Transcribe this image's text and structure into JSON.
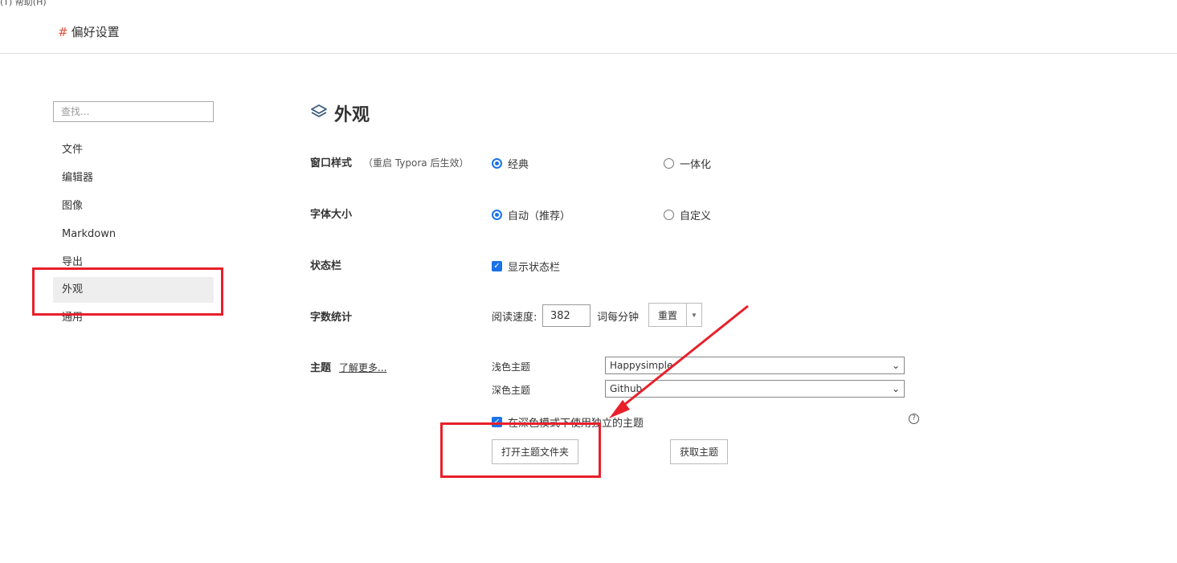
{
  "window": {
    "menubar": "(T)  帮助(H)",
    "title": "偏好设置",
    "title_prefix": "#"
  },
  "sidebar": {
    "search_placeholder": "查找...",
    "items": [
      {
        "label": "文件"
      },
      {
        "label": "编辑器"
      },
      {
        "label": "图像"
      },
      {
        "label": "Markdown"
      },
      {
        "label": "导出"
      },
      {
        "label": "外观",
        "active": true
      },
      {
        "label": "通用"
      }
    ]
  },
  "section": {
    "title": "外观",
    "icon": "layers-icon"
  },
  "window_style": {
    "label": "窗口样式",
    "hint": "（重启 Typora 后生效）",
    "option_classic": "经典",
    "option_unified": "一体化",
    "selected": "经典"
  },
  "font_size": {
    "label": "字体大小",
    "option_auto": "自动（推荐）",
    "option_custom": "自定义",
    "selected": "自动（推荐）"
  },
  "status_bar": {
    "label": "状态栏",
    "show_label": "显示状态栏",
    "checked": true
  },
  "word_count": {
    "label": "字数统计",
    "speed_label": "阅读速度:",
    "speed_value": "382",
    "unit": "词每分钟",
    "reset_label": "重置"
  },
  "theme": {
    "label": "主题",
    "learn_more": "了解更多...",
    "light_label": "浅色主题",
    "light_value": "Happysimple",
    "dark_label": "深色主题",
    "dark_value": "Github",
    "separate_dark_label": "在深色模式下使用独立的主题",
    "separate_dark_checked": true,
    "open_folder_label": "打开主题文件夹",
    "get_themes_label": "获取主题"
  },
  "colors": {
    "accent": "#1a73e8",
    "annotation": "#e8202a",
    "hash": "#e0533d"
  }
}
